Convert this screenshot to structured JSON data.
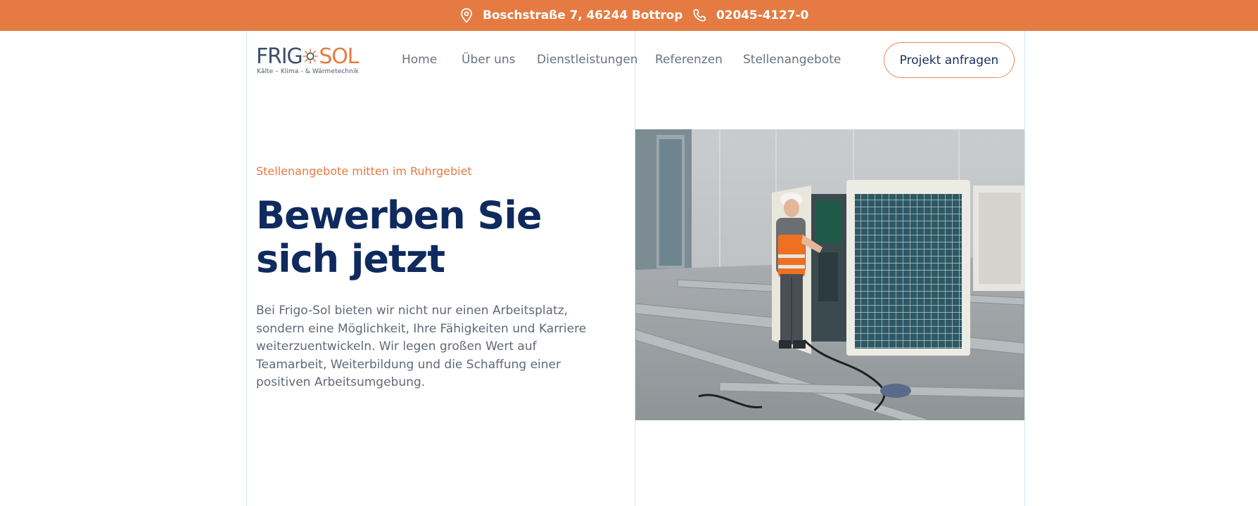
{
  "topbar": {
    "address": "Boschstraße 7, 46244 Bottrop",
    "phone": "02045-4127-0",
    "background_color": "#e57b42",
    "address_icon": "map-pin-icon",
    "phone_icon": "phone-icon"
  },
  "header": {
    "logo": {
      "word_left": "FRIG",
      "word_right": "SOL",
      "tagline": "Kälte – Klima - & Wärmetechnik"
    },
    "nav": [
      {
        "label": "Home"
      },
      {
        "label": "Über uns"
      },
      {
        "label": "Dienstleistungen"
      },
      {
        "label": "Referenzen"
      },
      {
        "label": "Stellenangebote"
      }
    ],
    "cta_label": "Projekt anfragen"
  },
  "hero": {
    "eyebrow": "Stellenangebote mitten im Ruhrgebiet",
    "title_line1": "Bewerben Sie",
    "title_line2": "sich jetzt",
    "body": "Bei Frigo-Sol bieten wir nicht nur einen Arbeitsplatz, sondern eine Möglichkeit, Ihre Fähigkeiten und Karriere weiterzuentwickeln. Wir legen großen Wert auf Teamarbeit, Weiterbildung und die Schaffung einer positiven Arbeitsumgebung."
  },
  "colors": {
    "accent": "#e57b42",
    "navy": "#0f2a5e",
    "text": "#616878",
    "gridline": "#d9e6f2"
  }
}
